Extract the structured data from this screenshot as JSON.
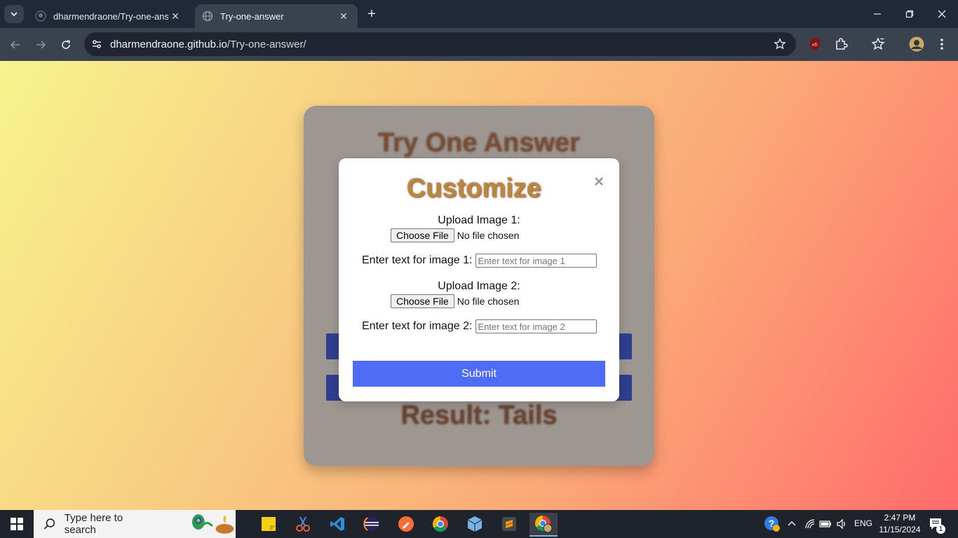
{
  "browser": {
    "tabs": [
      {
        "title": "dharmendraone/Try-one-answer",
        "active": false
      },
      {
        "title": "Try-one-answer",
        "active": true
      }
    ],
    "url_host": "dharmendraone.github.io",
    "url_path": "/Try-one-answer/"
  },
  "card": {
    "title": "Try One Answer",
    "result": "Result: Tails"
  },
  "modal": {
    "title": "Customize",
    "close_glyph": "×",
    "upload1_label": "Upload Image 1:",
    "upload2_label": "Upload Image 2:",
    "choose_file_label": "Choose File",
    "no_file_text": "No file chosen",
    "text1_label": "Enter text for image 1:",
    "text1_placeholder": "Enter text for image 1",
    "text2_label": "Enter text for image 2:",
    "text2_placeholder": "Enter text for image 2",
    "submit_label": "Submit"
  },
  "taskbar": {
    "search_placeholder": "Type here to search",
    "language": "ENG",
    "time": "2:47 PM",
    "date": "11/15/2024",
    "notification_count": "1"
  },
  "colors": {
    "page_gradient": [
      "#f7f38d",
      "#ff6b6b"
    ],
    "submit_button": "#4f6cf7",
    "card_bar": "#2f3f8f"
  },
  "icons": [
    "search-tabs-icon",
    "github-icon",
    "globe-icon",
    "close-icon",
    "plus-icon",
    "minimize-icon",
    "maximize-icon",
    "window-close-icon",
    "back-icon",
    "forward-icon",
    "reload-icon",
    "site-info-icon",
    "bookmark-star-icon",
    "ublock-icon",
    "extensions-icon",
    "bookmarks-icon",
    "profile-avatar",
    "menu-icon",
    "windows-start-icon",
    "search-icon"
  ]
}
